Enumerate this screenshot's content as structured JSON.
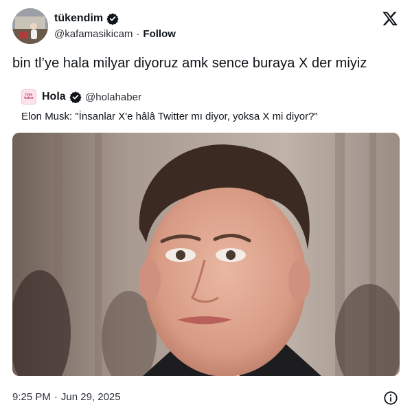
{
  "author": {
    "display_name": "tükendim",
    "handle": "@kafamasikicam",
    "separator": "·",
    "follow_label": "Follow",
    "avatar_icon": "user-avatar",
    "verified_icon": "verified-badge-icon"
  },
  "platform_icon": "x-logo-icon",
  "tweet": {
    "text": "bin tl’ye hala milyar diyoruz amk sence buraya X der miyiz"
  },
  "quoted_tweet": {
    "display_name": "Hola",
    "handle": "@holahaber",
    "avatar_text": "hola haber",
    "text": "Elon Musk: \"İnsanlar X'e hâlâ Twitter mı diyor, yoksa X mi diyor?\""
  },
  "footer": {
    "time": "9:25 PM",
    "separator": "·",
    "date": "Jun 29, 2025",
    "info_icon": "info-icon"
  },
  "colors": {
    "text": "#0f1419",
    "secondary": "#2a2f35",
    "verified": "#0f1419"
  }
}
